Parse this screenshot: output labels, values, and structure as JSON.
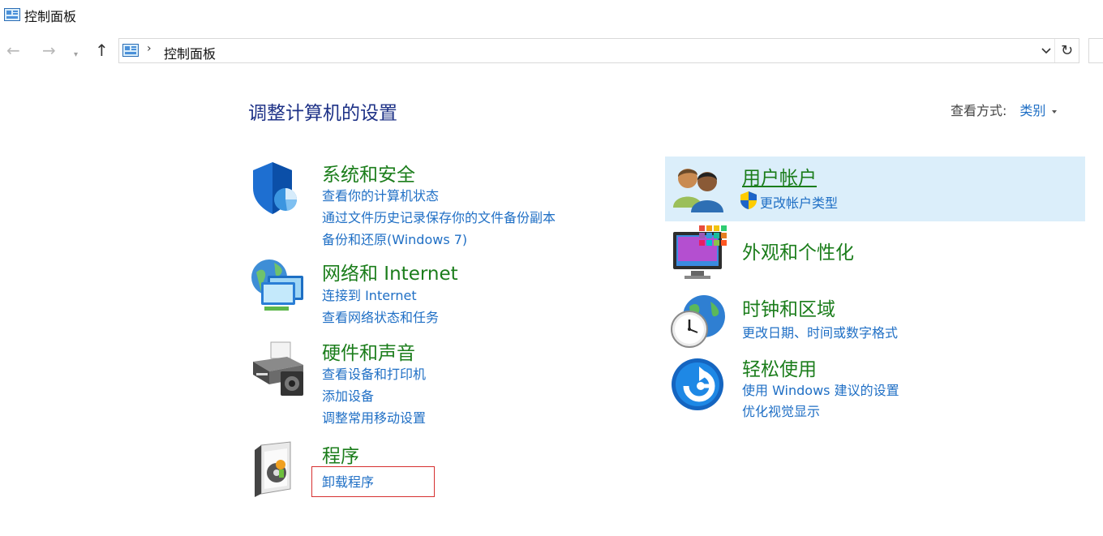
{
  "window": {
    "title": "控制面板",
    "icon": "control-panel-icon"
  },
  "nav": {
    "back_icon": "←",
    "forward_icon": "→",
    "recent_icon": "⌄",
    "up_icon": "↑",
    "breadcrumb_sep": "›",
    "breadcrumb": "控制面板",
    "refresh_icon": "↻"
  },
  "main": {
    "heading": "调整计算机的设置",
    "view_by_label": "查看方式:",
    "view_by_value": "类别"
  },
  "categories_left": [
    {
      "title": "系统和安全",
      "links": [
        "查看你的计算机状态",
        "通过文件历史记录保存你的文件备份副本",
        "备份和还原(Windows 7)"
      ]
    },
    {
      "title": "网络和 Internet",
      "links": [
        "连接到 Internet",
        "查看网络状态和任务"
      ]
    },
    {
      "title": "硬件和声音",
      "links": [
        "查看设备和打印机",
        "添加设备",
        "调整常用移动设置"
      ]
    },
    {
      "title": "程序",
      "links": [
        "卸载程序"
      ]
    }
  ],
  "categories_right": [
    {
      "title": "用户帐户",
      "links": [
        "更改帐户类型"
      ]
    },
    {
      "title": "外观和个性化",
      "links": []
    },
    {
      "title": "时钟和区域",
      "links": [
        "更改日期、时间或数字格式"
      ]
    },
    {
      "title": "轻松使用",
      "links": [
        "使用 Windows 建议的设置",
        "优化视觉显示"
      ]
    }
  ],
  "colors": {
    "category_title": "#1b7d1b",
    "link": "#1f6fc5",
    "heading": "#1e3287",
    "hover_bg": "#dbeefa",
    "highlight": "#d63030"
  }
}
